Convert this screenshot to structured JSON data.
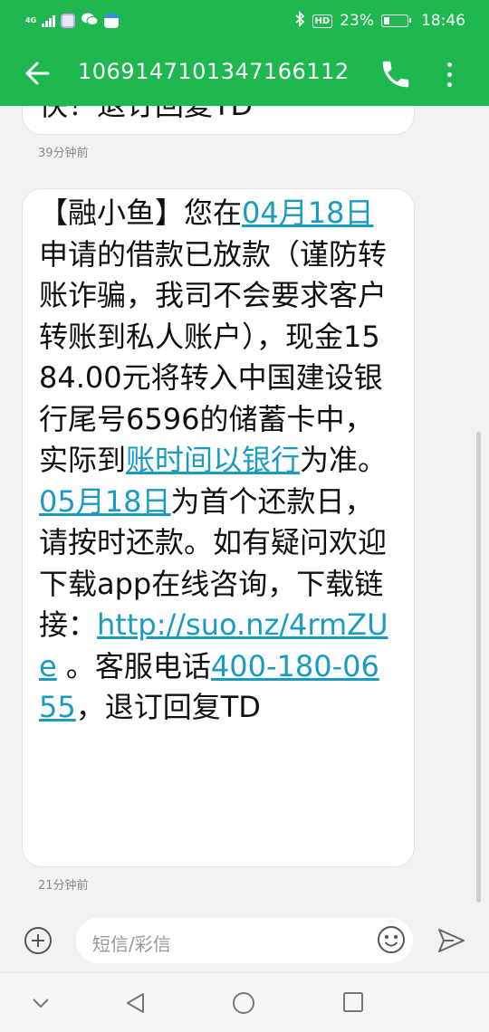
{
  "status_bar": {
    "network": "4G",
    "battery_percent": "23%",
    "battery_level": 0.23,
    "hd_label": "HD",
    "time": "18:46"
  },
  "header": {
    "title": "1069147101347166112",
    "icons": [
      "back-arrow-icon",
      "phone-icon",
      "more-vertical-icon"
    ]
  },
  "conversation": {
    "messages": [
      {
        "cut_text": "快！退订回复TD",
        "timestamp": "39分钟前"
      },
      {
        "parts": [
          "【融小鱼】您在",
          "04月18日",
          "申请的借款已放款（谨防转账诈骗，我司不会要求客户转账到私人账户），现金1584.00元将转入中国建设银行尾号6596的储蓄卡中，实际到",
          "账时间以银行",
          "为准。",
          "05月18日",
          "为首个还款日，请按时还款。如有疑问欢迎下载app在线咨询，下载链接：",
          "http://suo.nz/4rmZUe",
          " 。客服电话",
          "400-180-0655",
          "，退订回复TD"
        ],
        "timestamp": "21分钟前"
      }
    ]
  },
  "composer": {
    "placeholder": "短信/彩信",
    "icons": [
      "add-circle-icon",
      "emoji-icon",
      "send-icon"
    ]
  },
  "colors": {
    "header_green": "#1fb750",
    "link_blue": "#1a9bc2",
    "background": "#f2f2f2"
  },
  "nav_bar": {
    "icons": [
      "nav-down-icon",
      "nav-back-icon",
      "nav-home-icon",
      "nav-recent-icon"
    ]
  }
}
